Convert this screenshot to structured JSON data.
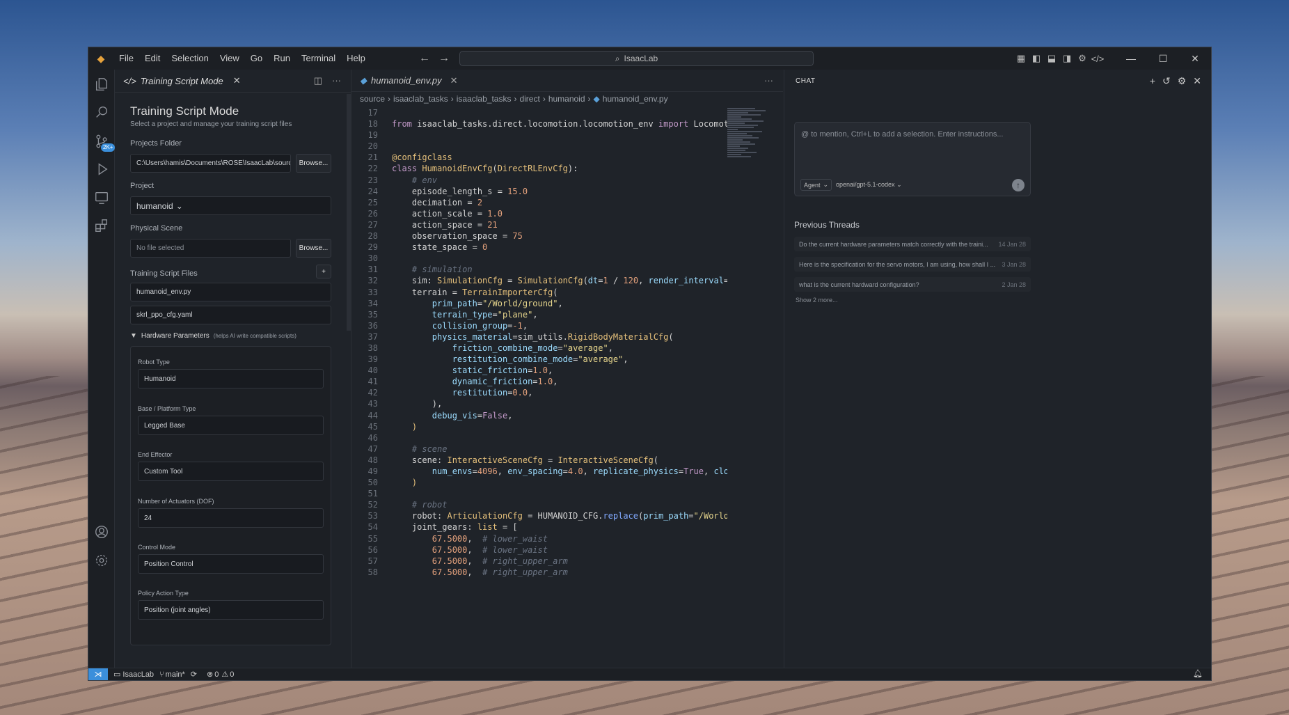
{
  "menu": [
    "File",
    "Edit",
    "Selection",
    "View",
    "Go",
    "Run",
    "Terminal",
    "Help"
  ],
  "search": {
    "text": "IsaacLab"
  },
  "activity": {
    "badge": "2K+"
  },
  "side": {
    "tab": "Training Script Mode",
    "title": "Training Script Mode",
    "subtitle": "Select a project and manage your training script files",
    "projects_folder_label": "Projects Folder",
    "projects_folder_value": "C:\\Users\\hamis\\Documents\\ROSE\\IsaacLab\\source...",
    "browse": "Browse...",
    "project_label": "Project",
    "project_value": "humanoid",
    "scene_label": "Physical Scene",
    "scene_value": "No file selected",
    "files_label": "Training Script Files",
    "files": [
      "humanoid_env.py",
      "skrl_ppo_cfg.yaml"
    ],
    "hw_title": "Hardware Parameters",
    "hw_hint": "(helps AI write compatible scripts)",
    "hw": [
      {
        "label": "Robot Type",
        "value": "Humanoid"
      },
      {
        "label": "Base / Platform Type",
        "value": "Legged Base"
      },
      {
        "label": "End Effector",
        "value": "Custom Tool"
      },
      {
        "label": "Number of Actuators (DOF)",
        "value": "24"
      },
      {
        "label": "Control Mode",
        "value": "Position Control"
      },
      {
        "label": "Policy Action Type",
        "value": "Position (joint angles)"
      }
    ]
  },
  "editor": {
    "tab": "humanoid_env.py",
    "breadcrumb": [
      "source",
      "isaaclab_tasks",
      "isaaclab_tasks",
      "direct",
      "humanoid",
      "humanoid_env.py"
    ]
  },
  "chat": {
    "title": "CHAT",
    "placeholder": "@ to mention, Ctrl+L to add a selection. Enter instructions...",
    "agent": "Agent",
    "model": "openai/gpt-5.1-codex",
    "previous": "Previous Threads",
    "threads": [
      {
        "text": "Do the current hardware parameters match correctly with the traini...",
        "date": "14 Jan 28"
      },
      {
        "text": "Here is the specification for the servo motors, I am using, how shall I ...",
        "date": "3 Jan 28"
      },
      {
        "text": "what is the current hardward configuration?",
        "date": "2 Jan 28"
      }
    ],
    "show_more": "Show 2 more..."
  },
  "status": {
    "project": "IsaacLab",
    "branch": "main*",
    "errors": "0",
    "warnings": "0"
  }
}
